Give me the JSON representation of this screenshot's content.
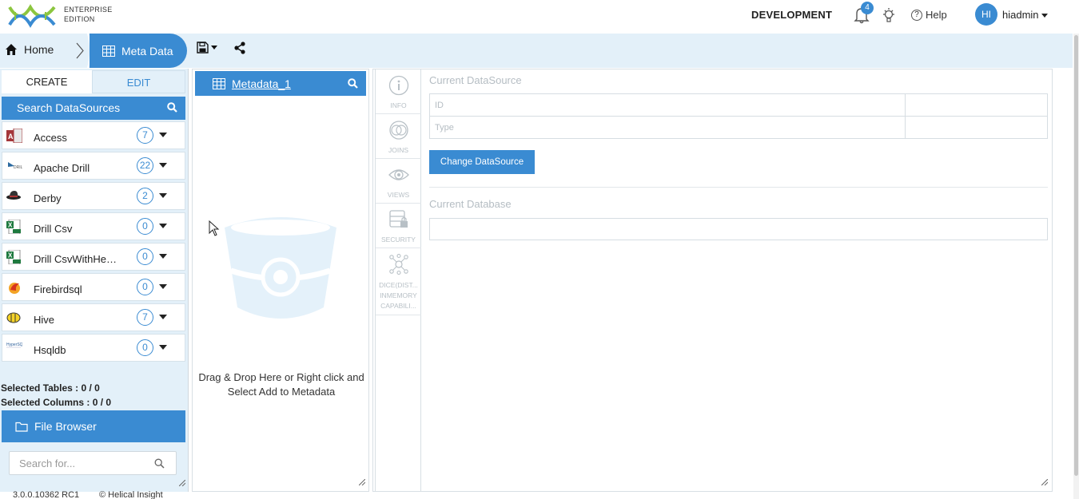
{
  "header": {
    "edition_line1": "ENTERPRISE",
    "edition_line2": "EDITION",
    "environment": "DEVELOPMENT",
    "notification_count": "4",
    "help_label": "Help",
    "avatar_initials": "HI",
    "username": "hiadmin"
  },
  "breadcrumb": {
    "home": "Home",
    "current": "Meta Data"
  },
  "left_panel": {
    "tabs": {
      "create": "CREATE",
      "edit": "EDIT"
    },
    "search_datasources": "Search DataSources",
    "datasources": [
      {
        "name": "Access",
        "count": "7",
        "icon": "access-icon"
      },
      {
        "name": "Apache Drill",
        "count": "22",
        "icon": "drill-icon"
      },
      {
        "name": "Derby",
        "count": "2",
        "icon": "derby-icon"
      },
      {
        "name": "Drill Csv",
        "count": "0",
        "icon": "csv-icon"
      },
      {
        "name": "Drill CsvWithHeader",
        "count": "0",
        "icon": "csv-icon"
      },
      {
        "name": "Firebirdsql",
        "count": "0",
        "icon": "firebird-icon"
      },
      {
        "name": "Hive",
        "count": "7",
        "icon": "hive-icon"
      },
      {
        "name": "Hsqldb",
        "count": "0",
        "icon": "hsqldb-icon"
      }
    ],
    "selected_tables": "Selected Tables : 0 / 0",
    "selected_columns": "Selected Columns : 0 / 0",
    "file_browser": "File Browser",
    "search_placeholder": "Search for..."
  },
  "metadata_panel": {
    "title": "Metadata_1",
    "drop_hint_line1": "Drag & Drop Here or Right click and",
    "drop_hint_line2": "Select Add to Metadata"
  },
  "side_tabs": {
    "info": "INFO",
    "joins": "JOINS",
    "views": "VIEWS",
    "security": "SECURITY",
    "dice_line1": "DICE(DIST...",
    "dice_line2": "INMEMORY",
    "dice_line3": "CAPABILI..."
  },
  "details": {
    "current_datasource": "Current DataSource",
    "id_label": "ID",
    "id_value": "",
    "type_label": "Type",
    "type_value": "",
    "change_button": "Change DataSource",
    "current_database": "Current Database",
    "database_value": ""
  },
  "footer": {
    "version": "3.0.0.10362 RC1",
    "copyright": "© Helical Insight"
  },
  "colors": {
    "accent": "#3a8bd2",
    "band": "#e3f0f9",
    "logo_green": "#8cc63f"
  }
}
